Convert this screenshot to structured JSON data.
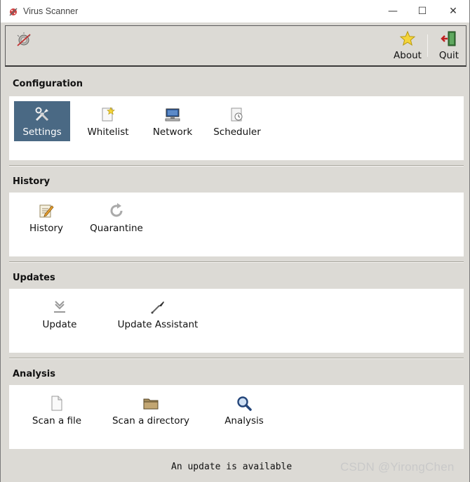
{
  "window": {
    "title": "Virus Scanner",
    "controls": {
      "minimize": "—",
      "maximize": "☐",
      "close": "✕"
    }
  },
  "toolbar": {
    "about_label": "About",
    "quit_label": "Quit"
  },
  "sections": {
    "configuration": {
      "title": "Configuration",
      "items": [
        "Settings",
        "Whitelist",
        "Network",
        "Scheduler"
      ],
      "selected": "Settings"
    },
    "history": {
      "title": "History",
      "items": [
        "History",
        "Quarantine"
      ]
    },
    "updates": {
      "title": "Updates",
      "items": [
        "Update",
        "Update Assistant"
      ]
    },
    "analysis": {
      "title": "Analysis",
      "items": [
        "Scan a file",
        "Scan a directory",
        "Analysis"
      ]
    }
  },
  "status_text": "An update is available",
  "watermark": "CSDN @YirongChen",
  "colors": {
    "selected_bg": "#4a6984",
    "window_bg": "#dcdad5",
    "panel_bg": "#ffffff"
  }
}
